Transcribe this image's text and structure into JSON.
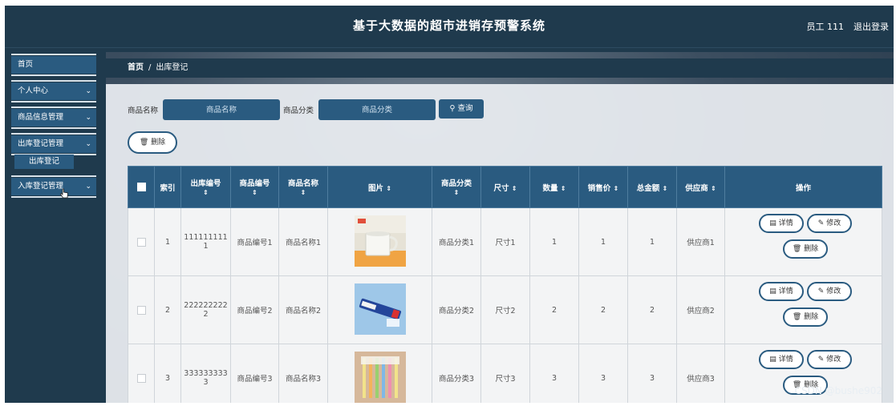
{
  "header": {
    "title": "基于大数据的超市进销存预警系统",
    "user": "员工 111",
    "logout": "退出登录"
  },
  "sidebar": {
    "items": [
      {
        "label": "首页",
        "chevron": ""
      },
      {
        "label": "个人中心",
        "chevron": "⌄"
      },
      {
        "label": "商品信息管理",
        "chevron": "⌄"
      },
      {
        "label": "出库登记管理",
        "chevron": "⌄"
      },
      {
        "label": "入库登记管理",
        "chevron": "⌄"
      }
    ],
    "sub_item": "出库登记"
  },
  "breadcrumb": {
    "home": "首页",
    "sep": "/",
    "current": "出库登记"
  },
  "search": {
    "name_label": "商品名称",
    "name_placeholder": "商品名称",
    "category_label": "商品分类",
    "category_placeholder": "商品分类",
    "query_label": "查询"
  },
  "toolbar": {
    "delete_label": "删除"
  },
  "table": {
    "headers": [
      "",
      "索引",
      "出库编号",
      "商品编号",
      "商品名称",
      "图片",
      "商品分类",
      "尺寸",
      "数量",
      "销售价",
      "总金额",
      "供应商",
      "操作"
    ],
    "sort_symbol": "⇕",
    "rows": [
      {
        "index": "1",
        "out_no": "1111111111",
        "goods_no": "商品编号1",
        "goods_name": "商品名称1",
        "image": "mug-photo",
        "category": "商品分类1",
        "size": "尺寸1",
        "qty": "1",
        "price": "1",
        "total": "1",
        "supplier": "供应商1"
      },
      {
        "index": "2",
        "out_no": "2222222222",
        "goods_no": "商品编号2",
        "goods_name": "商品名称2",
        "image": "toothpaste-photo",
        "category": "商品分类2",
        "size": "尺寸2",
        "qty": "2",
        "price": "2",
        "total": "2",
        "supplier": "供应商2"
      },
      {
        "index": "3",
        "out_no": "3333333333",
        "goods_no": "商品编号3",
        "goods_name": "商品名称3",
        "image": "toothbrush-photo",
        "category": "商品分类3",
        "size": "尺寸3",
        "qty": "3",
        "price": "3",
        "total": "3",
        "supplier": "供应商3"
      }
    ],
    "actions": {
      "detail": "详情",
      "edit": "修改",
      "delete": "删除"
    }
  },
  "watermark": "CSDN @bushe902",
  "colors": {
    "nav_bg": "#1f3a4d",
    "accent": "#2a5b80",
    "header_bg": "#2a5b80"
  }
}
